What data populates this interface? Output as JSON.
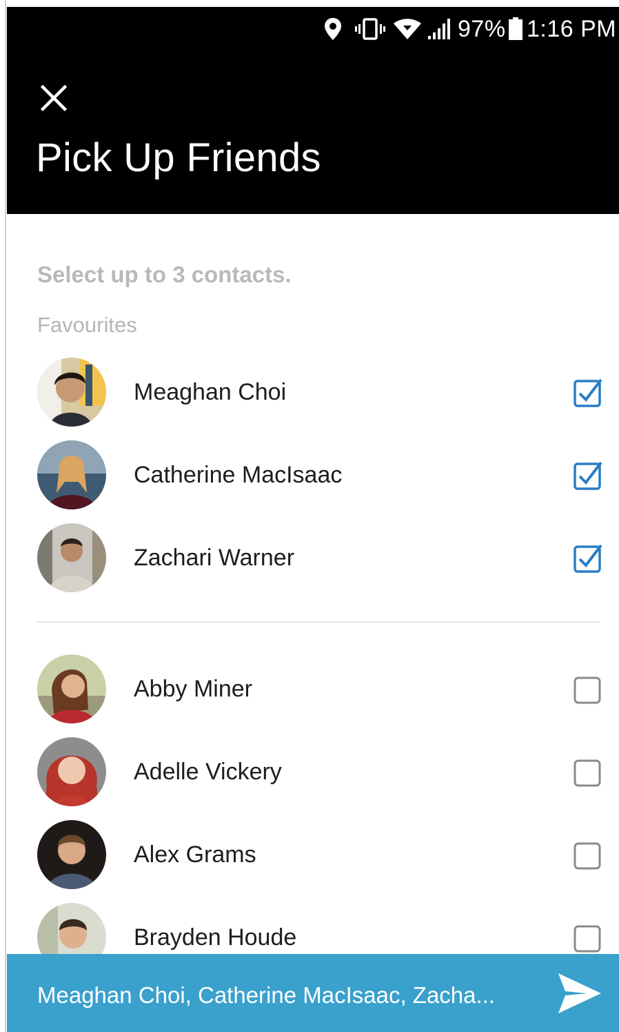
{
  "status_bar": {
    "battery": "97%",
    "time": "1:16 PM",
    "icons": [
      "location-icon",
      "vibrate-icon",
      "wifi-icon",
      "signal-icon",
      "battery-icon"
    ]
  },
  "header": {
    "close_icon": "close-icon",
    "title": "Pick Up Friends"
  },
  "instruction": "Select up to 3 contacts.",
  "favourites_label": "Favourites",
  "favourites": [
    {
      "name": "Meaghan Choi",
      "checked": true
    },
    {
      "name": "Catherine MacIsaac",
      "checked": true
    },
    {
      "name": "Zachari Warner",
      "checked": true
    }
  ],
  "contacts": [
    {
      "name": "Abby Miner",
      "checked": false
    },
    {
      "name": "Adelle Vickery",
      "checked": false
    },
    {
      "name": "Alex Grams",
      "checked": false
    },
    {
      "name": "Brayden Houde",
      "checked": false
    }
  ],
  "send_bar": {
    "summary": "Meaghan Choi, Catherine MacIsaac, Zacha...",
    "send_icon": "send-icon",
    "color": "#3aa0cc"
  },
  "colors": {
    "header_bg": "#000000",
    "check_blue": "#2a7dc4",
    "muted_text": "#b9b9b9"
  }
}
